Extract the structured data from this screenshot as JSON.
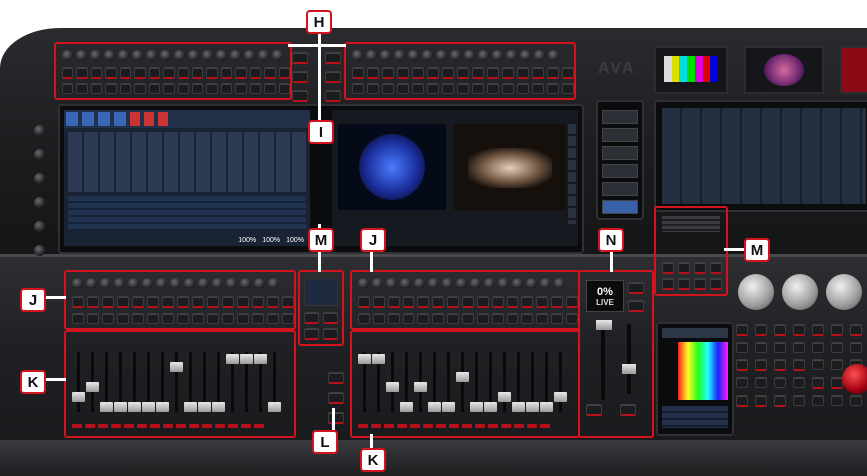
{
  "callouts": {
    "h": "H",
    "i": "I",
    "j_left": "J",
    "j_right": "J",
    "k_left": "K",
    "k_right": "K",
    "l": "L",
    "m_left": "M",
    "m_right": "M",
    "n": "N"
  },
  "master": {
    "level": "0%",
    "mode": "LIVE"
  },
  "screen_left": {
    "pct_a": "100%",
    "pct_b": "100%",
    "pct_c": "100%"
  },
  "brand": "AVA",
  "colors": {
    "callout_border": "#d2141e",
    "button_led": "#b8101a"
  }
}
